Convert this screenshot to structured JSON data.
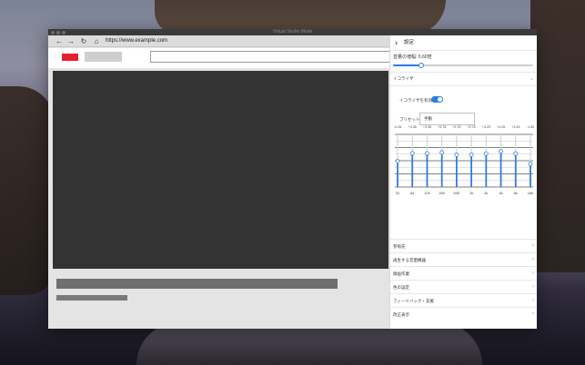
{
  "window": {
    "title": "Virtual Studio Mode"
  },
  "browser": {
    "url": "https://www.example.com",
    "nav_icons": [
      "back-arrow-icon",
      "forward-arrow-icon",
      "reload-icon",
      "home-icon"
    ]
  },
  "panel": {
    "title": "設定",
    "volume": {
      "label": "音量の増幅: 0.60倍",
      "value": 0.6
    },
    "equalizer": {
      "section_label": "イコライザ",
      "toggle_label": "イコライザを有効化",
      "enabled": true,
      "preset_label": "プリセット",
      "preset_value": "手動"
    },
    "footer_items": [
      "参照先",
      "再生する音量機器",
      "録画作業",
      "色の設定",
      "フィードバック・支援",
      "改正表示"
    ]
  },
  "chart_data": {
    "type": "bar",
    "categories": [
      "32",
      "64",
      "125",
      "250",
      "500",
      "1k",
      "2k",
      "4k",
      "8k",
      "16k"
    ],
    "values": [
      -0.25,
      3.35,
      3.35,
      3.75,
      2.75,
      2.75,
      3.25,
      4.25,
      3.25,
      -1.5
    ],
    "value_labels": [
      "-0.25",
      "+3.35",
      "+3.35",
      "+3.75",
      "+2.75",
      "+2.75",
      "+3.25",
      "+4.25",
      "+3.25",
      "-1.50"
    ],
    "ylim": [
      -12,
      12
    ],
    "grid": true,
    "colors": {
      "bar": "#2d7de0"
    }
  }
}
